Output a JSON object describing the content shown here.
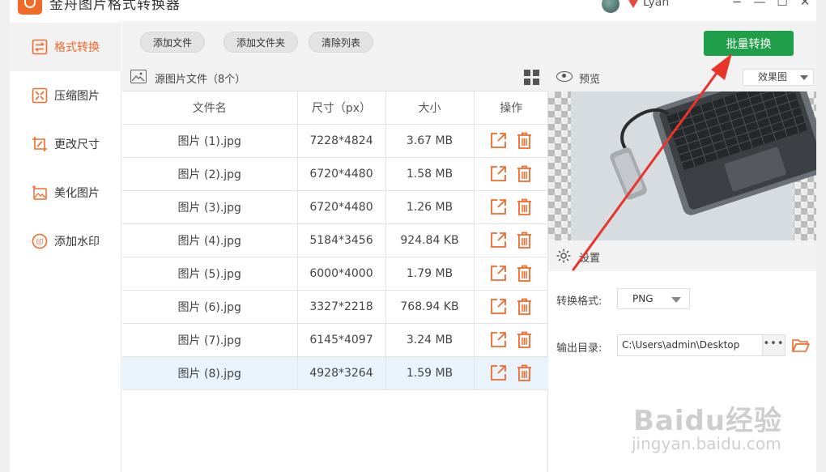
{
  "window": {
    "title": "金舟图片格式转换器",
    "username": "Lyan",
    "controls": [
      "−",
      "—",
      "☐",
      "✕"
    ]
  },
  "sidebar": {
    "items": [
      {
        "label": "格式转换",
        "icon": "swap-icon",
        "active": true
      },
      {
        "label": "压缩图片",
        "icon": "compress-icon",
        "active": false
      },
      {
        "label": "更改尺寸",
        "icon": "resize-icon",
        "active": false
      },
      {
        "label": "美化图片",
        "icon": "beautify-icon",
        "active": false
      },
      {
        "label": "添加水印",
        "icon": "watermark-icon",
        "active": false
      }
    ]
  },
  "toolbar": {
    "add_file": "添加文件",
    "add_folder": "添加文件夹",
    "clear_list": "清除列表",
    "batch_convert": "批量转换"
  },
  "file_list": {
    "title": "源图片文件（8个）",
    "columns": [
      "文件名",
      "尺寸（px）",
      "大小",
      "操作"
    ],
    "rows": [
      {
        "name": "图片 (1).jpg",
        "dims": "7228*4824",
        "size": "3.67 MB"
      },
      {
        "name": "图片 (2).jpg",
        "dims": "6720*4480",
        "size": "1.58 MB"
      },
      {
        "name": "图片 (3).jpg",
        "dims": "6720*4480",
        "size": "1.26 MB"
      },
      {
        "name": "图片 (4).jpg",
        "dims": "5184*3456",
        "size": "924.84 KB"
      },
      {
        "name": "图片 (5).jpg",
        "dims": "6000*4000",
        "size": "1.79 MB"
      },
      {
        "name": "图片 (6).jpg",
        "dims": "3327*2218",
        "size": "768.94 KB"
      },
      {
        "name": "图片 (7).jpg",
        "dims": "6145*4097",
        "size": "3.24 MB"
      },
      {
        "name": "图片 (8).jpg",
        "dims": "4928*3264",
        "size": "1.59 MB"
      }
    ],
    "selected_row": 8
  },
  "preview": {
    "label": "预览",
    "view_mode": "效果图"
  },
  "settings": {
    "label": "设置",
    "format_label": "转换格式:",
    "format_value": "PNG",
    "output_label": "输出目录:",
    "output_value": "C:\\Users\\admin\\Desktop",
    "browse_dots": "•••"
  },
  "watermark": {
    "brand": "Baidu经验",
    "url": "jingyan.baidu.com"
  },
  "colors": {
    "accent": "#f06a2a",
    "convert_button": "#1f9f4a",
    "annotation_arrow": "#e8352a",
    "selected_row": "#e8f3fc"
  }
}
